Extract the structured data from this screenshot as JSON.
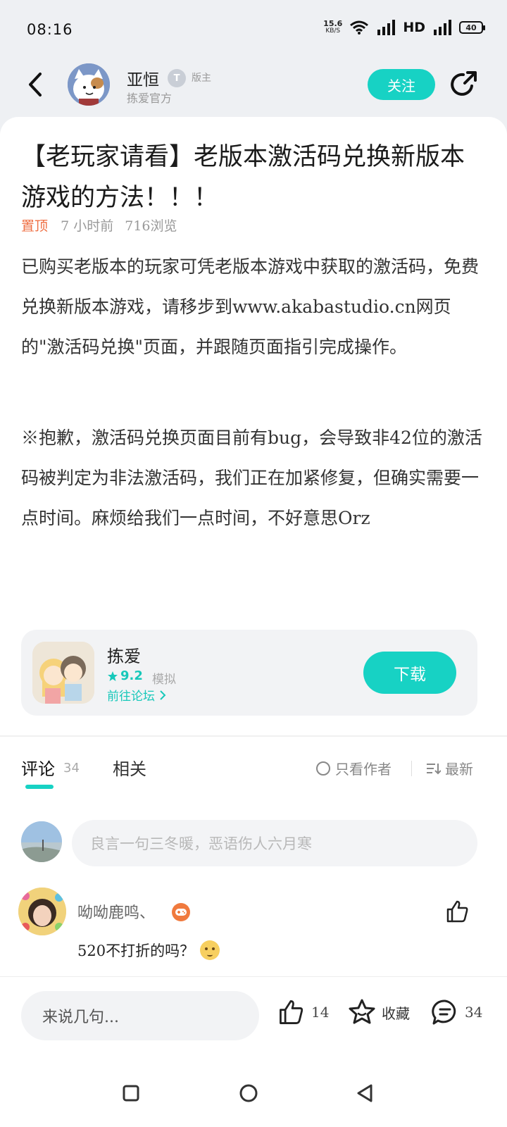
{
  "status_bar": {
    "time": "08:16",
    "speed": "15.6",
    "speed_unit": "KB/S",
    "hd": "HD",
    "battery": "40"
  },
  "header": {
    "author_name": "亚恒",
    "author_badge": "T",
    "author_role": "版主",
    "author_sub": "拣爱官方",
    "follow_label": "关注"
  },
  "post": {
    "title": "【老玩家请看】老版本激活码兑换新版本游戏的方法！！！",
    "pinned": "置顶",
    "time": "7 小时前",
    "views": "716浏览",
    "paragraph1": "已购买老版本的玩家可凭老版本游戏中获取的激活码，免费兑换新版本游戏，请移步到www.akabastudio.cn网页的\"激活码兑换\"页面，并跟随页面指引完成操作。",
    "paragraph2": "※抱歉，激活码兑换页面目前有bug，会导致非42位的激活码被判定为非法激活码，我们正在加紧修复，但确实需要一点时间。麻烦给我们一点时间，不好意思Orz"
  },
  "app_card": {
    "name": "拣爱",
    "rating": "9.2",
    "tag": "模拟",
    "forum_link": "前往论坛",
    "download_label": "下载"
  },
  "tabs": {
    "comments_label": "评论",
    "comments_count": "34",
    "related_label": "相关",
    "author_only": "只看作者",
    "sort_latest": "最新"
  },
  "comment_input": {
    "placeholder": "良言一句三冬暖，恶语伤人六月寒"
  },
  "comments": [
    {
      "user": "呦呦鹿鸣、",
      "text": "520不打折的吗？"
    }
  ],
  "bottom_bar": {
    "input_placeholder": "来说几句...",
    "like_count": "14",
    "fav_label": "收藏",
    "comment_count": "34"
  },
  "colors": {
    "accent": "#17d2c4",
    "pinned": "#ef6f43"
  }
}
